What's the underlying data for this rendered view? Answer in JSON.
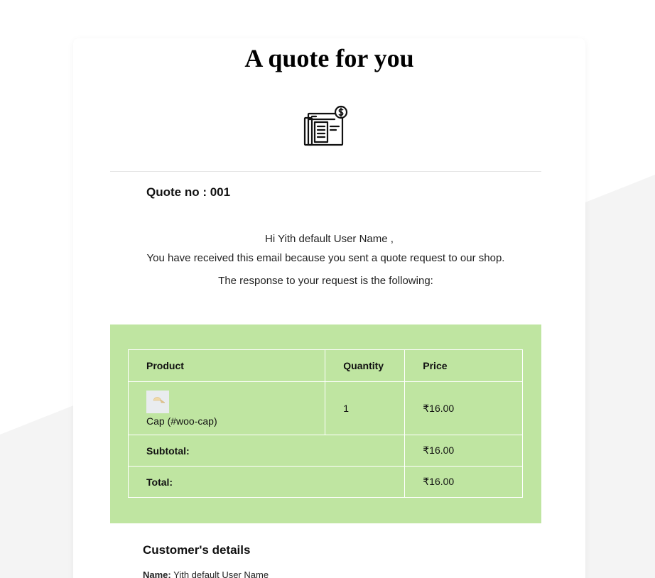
{
  "email": {
    "title": "A quote for you",
    "icon": "quote-document-dollar-icon",
    "quote_label": "Quote no : 001",
    "greeting": "Hi Yith default User Name ,",
    "message": "You have received this email because you sent a quote request to our shop. The response to your request is the following:"
  },
  "table": {
    "headers": [
      "Product",
      "Quantity",
      "Price"
    ],
    "items": [
      {
        "image_icon": "cap-thumbnail-icon",
        "name": "Cap (#woo-cap)",
        "quantity": "1",
        "price": "₹16.00"
      }
    ],
    "subtotal_label": "Subtotal:",
    "subtotal_value": "₹16.00",
    "total_label": "Total:",
    "total_value": "₹16.00"
  },
  "customer": {
    "heading": "Customer's details",
    "name_label": "Name:",
    "name_value": "Yith default User Name"
  },
  "colors": {
    "panel": "#bfe5a1",
    "background_shape": "#f4f4f4"
  }
}
